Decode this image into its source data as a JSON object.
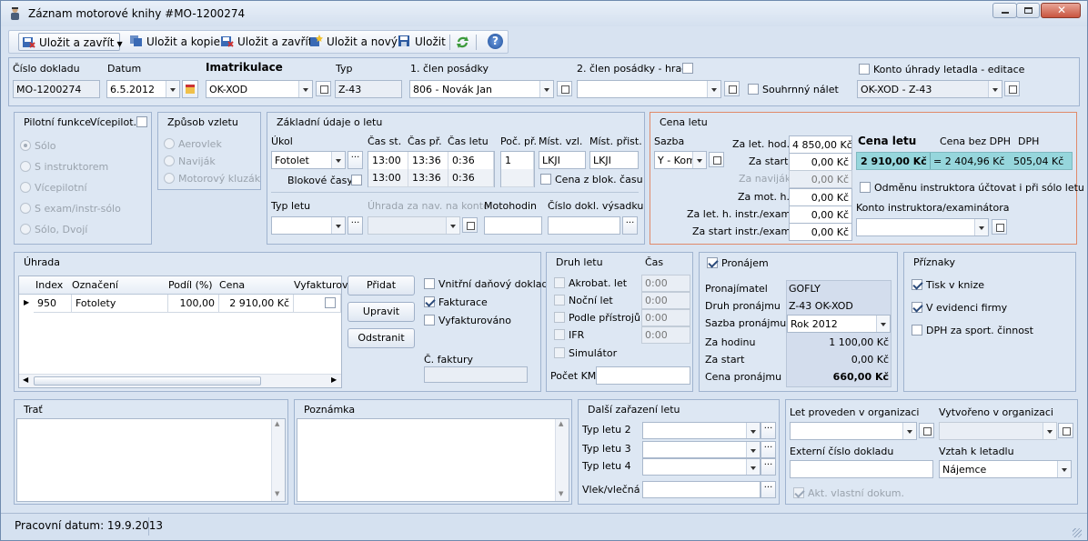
{
  "window": {
    "title": "Záznam motorové knihy  #MO-1200274"
  },
  "toolbar": {
    "save_close_dd": "Uložit a zavřít",
    "save_copy": "Uložit a kopie",
    "save_close": "Uložit a zavřít",
    "save_new": "Uložit a nový",
    "save": "Uložit"
  },
  "header": {
    "doc_no_label": "Číslo dokladu",
    "doc_no": "MO-1200274",
    "date_label": "Datum",
    "date": "6.5.2012",
    "imat_label": "Imatrikulace",
    "imat": "OK-XOD",
    "type_label": "Typ",
    "type": "Z-43",
    "crew1_label": "1. člen posádky",
    "crew1": "806 - Novák Jan",
    "crew2_label": "2. člen posádky  - hradí",
    "summary_label": "Souhrnný nálet",
    "konto_label": "Konto úhrady letadla - editace",
    "konto": "OK-XOD - Z-43"
  },
  "pilot": {
    "title": "Pilotní funkce",
    "vice_label": "Vícepilot.",
    "options": [
      "Sólo",
      "S instruktorem",
      "Vícepilotní",
      "S exam/instr-sólo",
      "Sólo, Dvojí"
    ],
    "selected": "Sólo"
  },
  "takeoff": {
    "title": "Způsob vzletu",
    "options": [
      "Aerovlek",
      "Naviják",
      "Motorový kluzák"
    ]
  },
  "basic": {
    "title": "Základní údaje o letu",
    "task_label": "Úkol",
    "task": "Fotolet",
    "block_label": "Blokové časy",
    "col_start": "Čas st.",
    "col_land": "Čas př.",
    "col_flight": "Čas letu",
    "rows": [
      {
        "start": "13:00",
        "land": "13:36",
        "flight": "0:36"
      },
      {
        "start": "13:00",
        "land": "13:36",
        "flight": "0:36"
      }
    ],
    "count_label": "Poč. př.",
    "count": "1",
    "dep_label": "Míst. vzl.",
    "dep": "LKJI",
    "arr_label": "Míst. přist.",
    "arr": "LKJI",
    "price_block_label": "Cena z blok. času",
    "flight_type_label": "Typ letu",
    "pay_nav_label": "Úhrada za nav. na konto",
    "motohours_label": "Motohodin",
    "drop_doc_label": "Číslo dokl. výsadku"
  },
  "price": {
    "title": "Cena letu",
    "rate_label": "Sazba",
    "rate": "Y - Komerč",
    "per_hour_label": "Za let. hod.",
    "per_hour": "4 850,00 Kč",
    "start_label": "Za start",
    "start": "0,00 Kč",
    "winch_label": "Za naviják",
    "winch": "0,00 Kč",
    "mot_label": "Za mot. h.",
    "mot": "0,00 Kč",
    "instr_label": "Za let. h. instr./exam.",
    "instr": "0,00 Kč",
    "instr_start_label": "Za start instr./exam.",
    "instr_start": "0,00 Kč",
    "total_label": "Cena letu",
    "total": "2 910,00 Kč",
    "no_vat_label": "Cena bez DPH",
    "no_vat": "= 2 404,96 Kč",
    "vat_label": "DPH",
    "vat": "505,04 Kč",
    "reward_label": "Odměnu instruktora účtovat i při sólo letu",
    "instr_konto_label": "Konto instruktora/examinátora"
  },
  "payment": {
    "title": "Úhrada",
    "columns": [
      "Index",
      "Označení",
      "Podíl (%)",
      "Cena",
      "Vyfakturov"
    ],
    "rows": [
      {
        "index": "950",
        "name": "Fotolety",
        "share": "100,00",
        "price": "2 910,00 Kč"
      }
    ],
    "add": "Přidat",
    "edit": "Upravit",
    "remove": "Odstranit",
    "internal_label": "Vnitřní daňový doklad",
    "invoice_label": "Fakturace",
    "invoiced_label": "Vyfakturováno",
    "invoice_no_label": "Č. faktury"
  },
  "kind": {
    "title": "Druh letu",
    "time_label": "Čas",
    "items": [
      {
        "label": "Akrobat. let",
        "time": "0:00"
      },
      {
        "label": "Noční let",
        "time": "0:00"
      },
      {
        "label": "Podle přístrojů",
        "time": "0:00"
      },
      {
        "label": "IFR",
        "time": "0:00"
      }
    ],
    "sim_label": "Simulátor",
    "km_label": "Počet KM"
  },
  "rental": {
    "title": "Pronájem",
    "lessor_label": "Pronajímatel",
    "lessor": "GOFLY",
    "kind_label": "Druh pronájmu",
    "kind": "Z-43 OK-XOD",
    "rate_label": "Sazba pronájmu",
    "rate": "Rok 2012",
    "hour_label": "Za hodinu",
    "hour": "1 100,00 Kč",
    "start_label": "Za start",
    "start": "0,00 Kč",
    "price_label": "Cena pronájmu",
    "price": "660,00 Kč"
  },
  "flags": {
    "title": "Příznaky",
    "print_label": "Tisk v knize",
    "firm_label": "V evidenci firmy",
    "vat_label": "DPH za sport. činnost"
  },
  "route": {
    "title": "Trať"
  },
  "note": {
    "title": "Poznámka"
  },
  "other": {
    "title": "Další zařazení letu",
    "t2_label": "Typ letu 2",
    "t3_label": "Typ letu 3",
    "t4_label": "Typ letu 4",
    "tow_label": "Vlek/vlečná"
  },
  "org": {
    "done_label": "Let proveden v organizaci",
    "created_label": "Vytvořeno v organizaci",
    "ext_label": "Externí číslo dokladu",
    "relation_label": "Vztah k letadlu",
    "relation": "Nájemce",
    "own_label": "Akt. vlastní dokum."
  },
  "status": {
    "text": "Pracovní datum: 19.9.2013"
  },
  "colors": {
    "accent": "#3b6aa5",
    "total_bg": "#96d6dc",
    "price_border": "#e08a6a"
  }
}
